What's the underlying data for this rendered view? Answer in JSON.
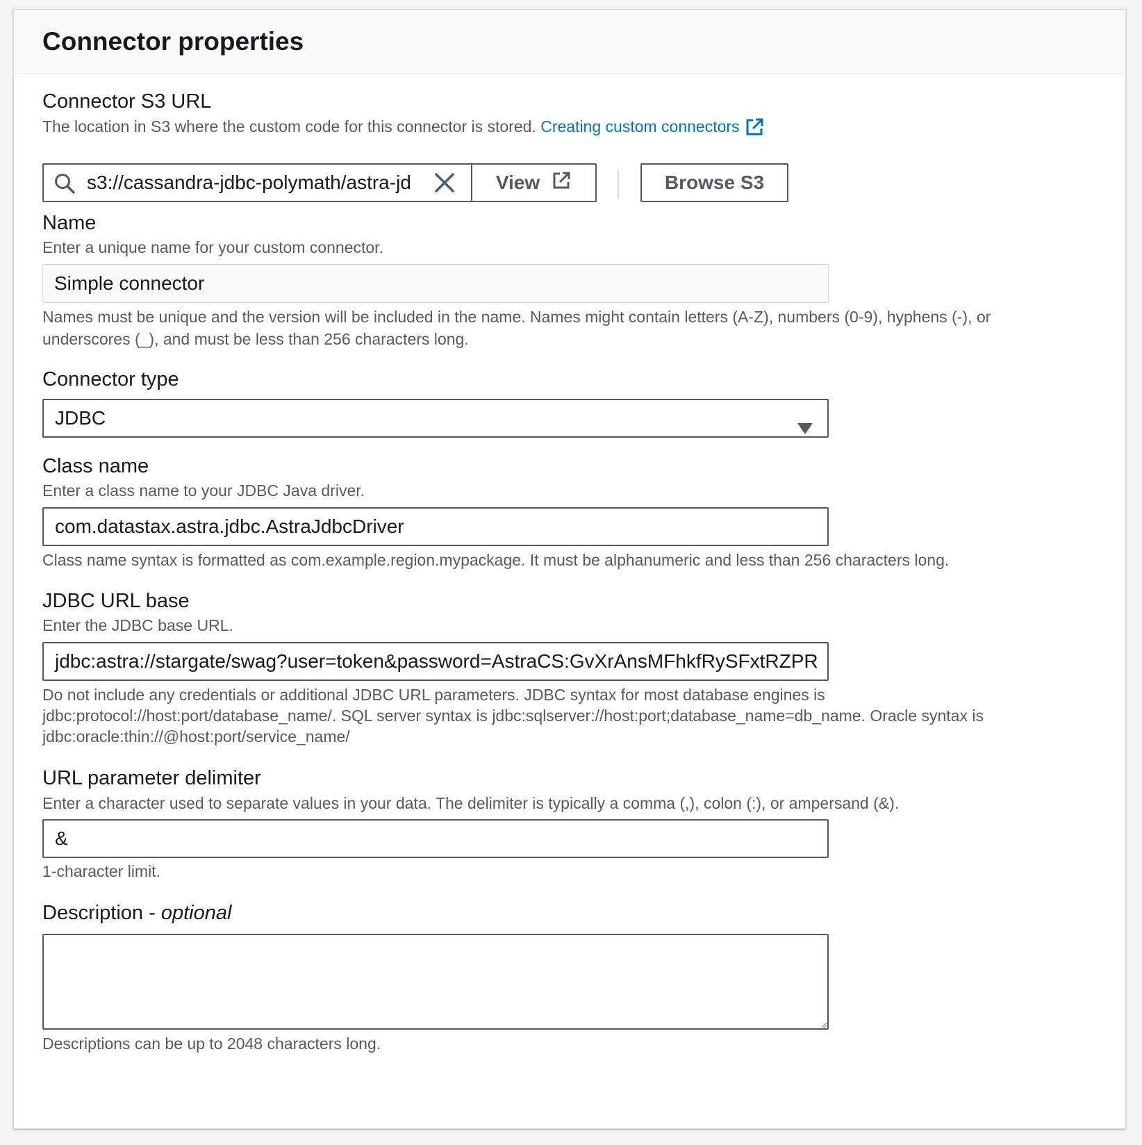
{
  "panel": {
    "title": "Connector properties"
  },
  "s3_url": {
    "label": "Connector S3 URL",
    "description": "The location in S3 where the custom code for this connector is stored.",
    "help_link": "Creating custom connectors",
    "value": "s3://cassandra-jdbc-polymath/astra-jd",
    "view_label": "View",
    "browse_label": "Browse S3"
  },
  "name": {
    "label": "Name",
    "description": "Enter a unique name for your custom connector.",
    "value": "Simple connector",
    "constraint": "Names must be unique and the version will be included in the name. Names might contain letters (A-Z), numbers (0-9), hyphens (-), or underscores (_), and must be less than 256 characters long."
  },
  "connector_type": {
    "label": "Connector type",
    "selected": "JDBC"
  },
  "class_name": {
    "label": "Class name",
    "description": "Enter a class name to your JDBC Java driver.",
    "value": "com.datastax.astra.jdbc.AstraJdbcDriver",
    "constraint": "Class name syntax is formatted as com.example.region.mypackage. It must be alphanumeric and less than 256 characters long."
  },
  "jdbc_url": {
    "label": "JDBC URL base",
    "description": "Enter the JDBC base URL.",
    "value": "jdbc:astra://stargate/swag?user=token&password=AstraCS:GvXrAnsMFhkfRySFxtRZPR",
    "constraint_lines": [
      "Do not include any credentials or additional JDBC URL parameters. JDBC syntax for most database engines is",
      "jdbc:protocol://host:port/database_name/. SQL server syntax is jdbc:sqlserver://host:port;database_name=db_name. Oracle syntax is",
      "jdbc:oracle:thin://@host:port/service_name/"
    ]
  },
  "delimiter": {
    "label": "URL parameter delimiter",
    "description": "Enter a character used to separate values in your data. The delimiter is typically a comma (,), colon (:), or ampersand (&).",
    "value": "&",
    "constraint": "1-character limit."
  },
  "description_field": {
    "label": "Description - ",
    "label_optional": "optional",
    "value": "",
    "constraint": "Descriptions can be up to 2048 characters long."
  },
  "icons": {
    "search": "search-icon",
    "clear": "close-icon",
    "external": "external-link-icon",
    "caret": "caret-down-icon"
  },
  "colors": {
    "link": "#0073bb",
    "border": "#545b64",
    "muted": "#545b64"
  }
}
